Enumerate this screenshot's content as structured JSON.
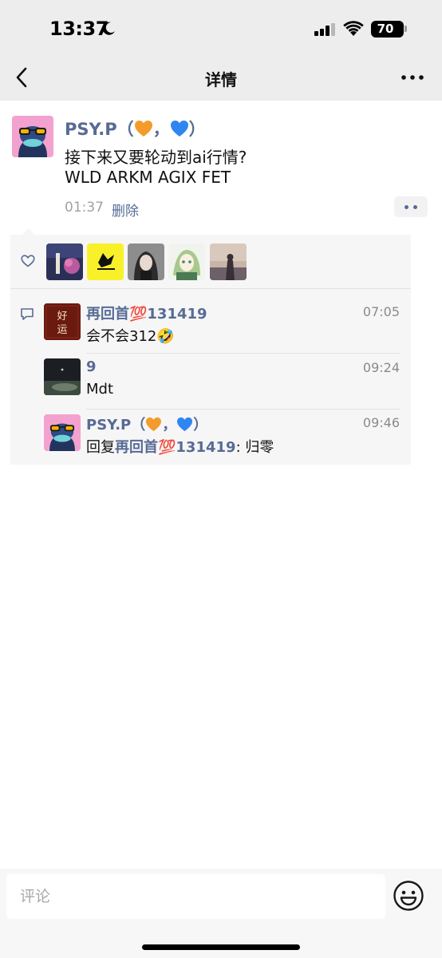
{
  "status_bar": {
    "time": "13:37",
    "battery": "70"
  },
  "nav": {
    "title": "详情"
  },
  "post": {
    "author": "PSY.P（",
    "author_sep": "，",
    "author_end": "）",
    "line1": "接下来又要轮动到ai行情?",
    "line2": "WLD ARKM AGIX FET",
    "time": "01:37",
    "delete_label": "删除"
  },
  "likes": {
    "count_visible": 5
  },
  "comments": [
    {
      "name": "再回首💯131419",
      "time": "07:05",
      "text": "会不会312🤣",
      "avatar_text": "好\n运"
    },
    {
      "name": "9",
      "time": "09:24",
      "text": "Mdt"
    },
    {
      "name_prefix": "PSY.P（",
      "name_sep": "，",
      "name_end": "）",
      "time": "09:46",
      "reply_prefix": "回复",
      "reply_to": "再回首💯131419",
      "reply_text": ": 归零"
    }
  ],
  "input": {
    "placeholder": "评论"
  },
  "colors": {
    "link": "#576b95",
    "panel": "#f6f6f6",
    "orange_heart": "#f39c2c",
    "blue_heart": "#2f86f0"
  }
}
